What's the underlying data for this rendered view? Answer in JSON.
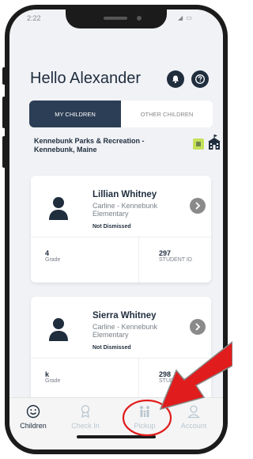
{
  "status_bar": {
    "time": "2:22",
    "right": "◢ ▭"
  },
  "header": {
    "greeting": "Hello Alexander"
  },
  "tabs": [
    {
      "label": "MY CHILDREN",
      "active": true
    },
    {
      "label": "OTHER CHILDREN",
      "active": false
    }
  ],
  "organization": {
    "name": "Kennebunk Parks & Recreation - Kennebunk, Maine"
  },
  "children": [
    {
      "name": "Lillian  Whitney",
      "school": "Carline - Kennebunk Elementary",
      "status": "Not Dismissed",
      "grade": "4",
      "grade_label": "Grade",
      "student_id": "297",
      "student_id_label": "STUDENT ID"
    },
    {
      "name": "Sierra Whitney",
      "school": "Carline - Kennebunk Elementary",
      "status": "Not Dismissed",
      "grade": "k",
      "grade_label": "Grade",
      "student_id": "298",
      "student_id_label": "STUDENT ID"
    }
  ],
  "nav": [
    {
      "label": "Children",
      "icon": "smiley-icon",
      "active": true
    },
    {
      "label": "Check In",
      "icon": "badge-icon",
      "active": false
    },
    {
      "label": "Pickup",
      "icon": "family-icon",
      "active": false
    },
    {
      "label": "Account",
      "icon": "user-icon",
      "active": false
    }
  ],
  "colors": {
    "primary": "#2c3e55",
    "accent": "#c5e15a",
    "annotation": "#e01c1c"
  }
}
